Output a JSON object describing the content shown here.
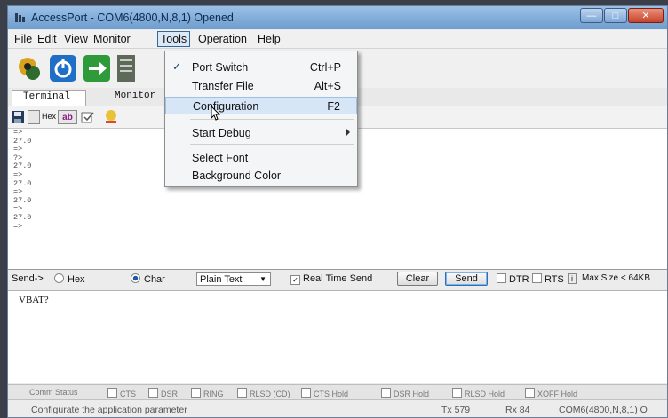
{
  "window": {
    "title": "AccessPort - COM6(4800,N,8,1) Opened"
  },
  "menubar": [
    "File",
    "Edit",
    "View",
    "Monitor",
    "Tools",
    "Operation",
    "Help"
  ],
  "tabs": [
    "Terminal",
    "Monitor"
  ],
  "subtoolbar": {
    "hex_label": "Hex",
    "ab_label": "ab"
  },
  "terminal_lines": [
    "=>",
    "27.0",
    "=>",
    "?>",
    "27.0",
    "=>",
    "27.0",
    "=>",
    "27.0",
    "=>",
    "27.0",
    "=>"
  ],
  "sendbar": {
    "send_label": "Send->",
    "hex_option": "Hex",
    "char_option": "Char",
    "format_value": "Plain Text",
    "realtime_label": "Real Time Send",
    "clear_label": "Clear",
    "send_button": "Send",
    "dtr_label": "DTR",
    "rts_label": "RTS",
    "info_label": "i",
    "max_size": "Max Size < 64KB"
  },
  "send_text": "VBAT?",
  "comm_status": {
    "label": "Comm Status",
    "items": [
      "CTS",
      "DSR",
      "RING",
      "RLSD (CD)",
      "CTS Hold",
      "DSR Hold",
      "RLSD Hold",
      "XOFF Hold"
    ]
  },
  "statusbar": {
    "hint": "Configurate the application parameter",
    "tx": "Tx 579",
    "rx": "Rx 84",
    "port": "COM6(4800,N,8,1) O"
  },
  "tools_menu": {
    "items": [
      {
        "label": "Port Switch",
        "shortcut": "Ctrl+P",
        "checked": true
      },
      {
        "label": "Transfer File",
        "shortcut": "Alt+S"
      },
      {
        "label": "Configuration",
        "shortcut": "F2",
        "highlighted": true
      },
      {
        "label": "Start Debug",
        "submenu": true
      },
      {
        "label": "Select Font"
      },
      {
        "label": "Background Color"
      }
    ]
  },
  "colors": {
    "titlebar": "#7fa8d6",
    "menu_highlight": "#d7e6f7",
    "close_button": "#c7432b"
  }
}
